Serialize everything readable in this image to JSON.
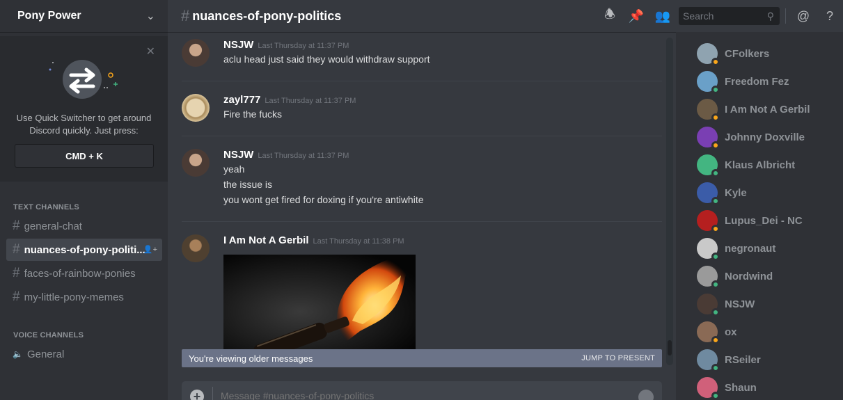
{
  "server": {
    "name": "Pony Power",
    "chevron_icon": "chevron-down-icon"
  },
  "quick_switcher": {
    "text": "Use Quick Switcher to get around Discord quickly. Just press:",
    "key": "CMD + K",
    "close_icon": "close-icon"
  },
  "categories": {
    "text": "TEXT CHANNELS",
    "voice": "VOICE CHANNELS"
  },
  "text_channels": [
    {
      "label": "general-chat"
    },
    {
      "label": "nuances-of-pony-politi...",
      "active": true
    },
    {
      "label": "faces-of-rainbow-ponies"
    },
    {
      "label": "my-little-pony-memes"
    }
  ],
  "voice_channels": [
    {
      "label": "General"
    }
  ],
  "header": {
    "channel": "nuances-of-pony-politics",
    "search_placeholder": "Search",
    "icons": [
      "bell-icon",
      "pin-icon",
      "members-icon",
      "search-icon",
      "mention-icon",
      "help-icon"
    ]
  },
  "messages": [
    {
      "author": "NSJW",
      "timestamp": "Last Thursday at 11:37 PM",
      "lines": [
        "aclu head just said they would withdraw support"
      ],
      "avatar_color": "#4a3b35"
    },
    {
      "author": "zayl777",
      "timestamp": "Last Thursday at 11:37 PM",
      "lines": [
        "Fire the fucks"
      ],
      "avatar_color": "#c8b28a"
    },
    {
      "author": "NSJW",
      "timestamp": "Last Thursday at 11:37 PM",
      "lines": [
        "yeah",
        "the issue is",
        "you wont get fired for doxing if you're antiwhite"
      ],
      "avatar_color": "#4a3b35"
    },
    {
      "author": "I Am Not A Gerbil",
      "timestamp": "Last Thursday at 11:38 PM",
      "lines": [],
      "avatar_color": "#6b5a45"
    }
  ],
  "older_banner": {
    "text": "You're viewing older messages",
    "jump": "JUMP TO PRESENT"
  },
  "composer": {
    "placeholder": "Message #nuances-of-pony-politics"
  },
  "members": [
    {
      "name": "CFolkers",
      "status": "idle",
      "color": "#8fa3b0"
    },
    {
      "name": "Freedom Fez",
      "status": "online",
      "color": "#6aa0c8"
    },
    {
      "name": "I Am Not A Gerbil",
      "status": "idle",
      "color": "#6b5a45"
    },
    {
      "name": "Johnny Doxville",
      "status": "idle",
      "color": "#7a3fb3"
    },
    {
      "name": "Klaus Albricht",
      "status": "online",
      "color": "#43b581"
    },
    {
      "name": "Kyle",
      "status": "online",
      "color": "#3b5ca8"
    },
    {
      "name": "Lupus_Dei - NC",
      "status": "idle",
      "color": "#b51f1f"
    },
    {
      "name": "negronaut",
      "status": "online",
      "color": "#c9c9c9"
    },
    {
      "name": "Nordwind",
      "status": "online",
      "color": "#9a9a9a"
    },
    {
      "name": "NSJW",
      "status": "online",
      "color": "#4a3b35"
    },
    {
      "name": "ox",
      "status": "idle",
      "color": "#8a6a55"
    },
    {
      "name": "RSeiler",
      "status": "online",
      "color": "#6f8aa0"
    },
    {
      "name": "Shaun",
      "status": "online",
      "color": "#d0607a"
    }
  ]
}
